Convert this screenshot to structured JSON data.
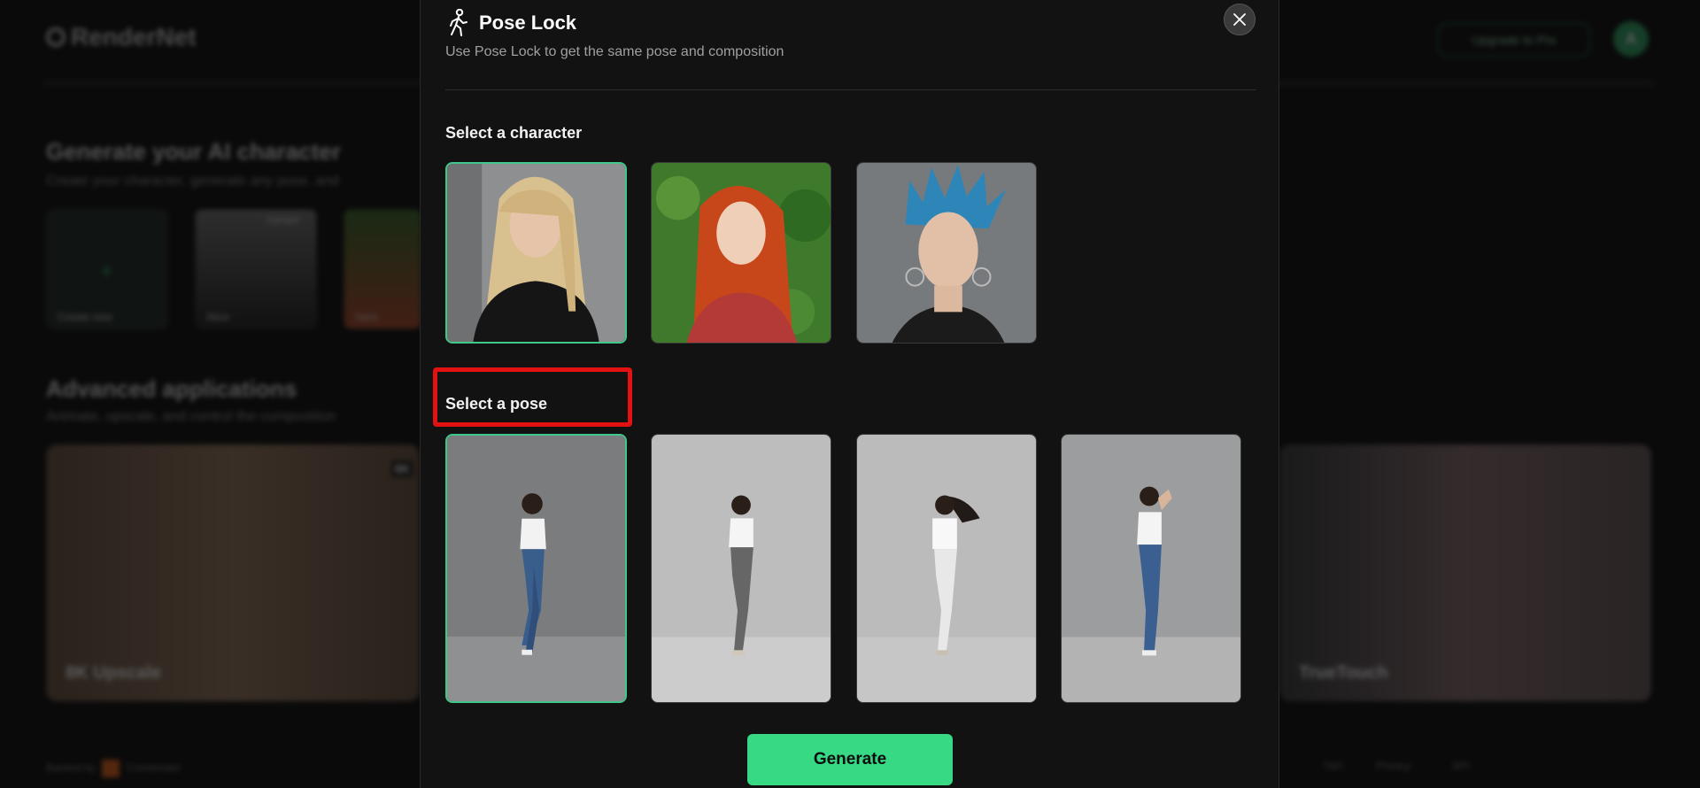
{
  "background": {
    "logo": "RenderNet",
    "upgrade_label": "Upgrade to Pro",
    "avatar_initial": "A",
    "generate_section": {
      "title": "Generate your AI character",
      "subtitle": "Create your character, generate any pose, and",
      "cards": [
        {
          "label": "Create new"
        },
        {
          "label": "Alice",
          "badge": "Sample"
        },
        {
          "label": "Sara"
        }
      ]
    },
    "advanced_section": {
      "title": "Advanced applications",
      "subtitle": "Animate, upscale, and control the composition",
      "cards": [
        {
          "label": "8K Upscale",
          "badge": "8K"
        },
        {
          "label": "TrueTouch"
        }
      ]
    },
    "footer": {
      "left": "Backed by",
      "brand": "Combinator",
      "links": [
        "T&C",
        "Privacy",
        "API"
      ]
    }
  },
  "modal": {
    "title": "Pose Lock",
    "description": "Use Pose Lock to get the same pose and composition",
    "character_heading": "Select a character",
    "pose_heading": "Select a pose",
    "generate_label": "Generate",
    "characters": [
      {
        "name": "blonde-woman-black-tshirt",
        "hair": "#d8c08f",
        "bg": "#8a8a8a",
        "top": "#151515",
        "selected": true
      },
      {
        "name": "redhead-woman-floral-top",
        "hair": "#c7471a",
        "bg": "#3f7a2c",
        "top": "#b33a36",
        "selected": false
      },
      {
        "name": "blue-spiked-hair-woman",
        "hair": "#2e86b8",
        "bg": "#777a7d",
        "top": "#1b1b1b",
        "selected": false
      }
    ],
    "poses": [
      {
        "name": "pose-blue-jeans-walking",
        "pants": "#3a5e8c",
        "selected": true
      },
      {
        "name": "pose-grey-jeans-turned",
        "pants": "#666666",
        "selected": false
      },
      {
        "name": "pose-white-pants-hair-flip",
        "pants": "#e8e8e8",
        "selected": false
      },
      {
        "name": "pose-blue-jeans-hand-on-head",
        "pants": "#3c5f92",
        "selected": false
      }
    ]
  }
}
